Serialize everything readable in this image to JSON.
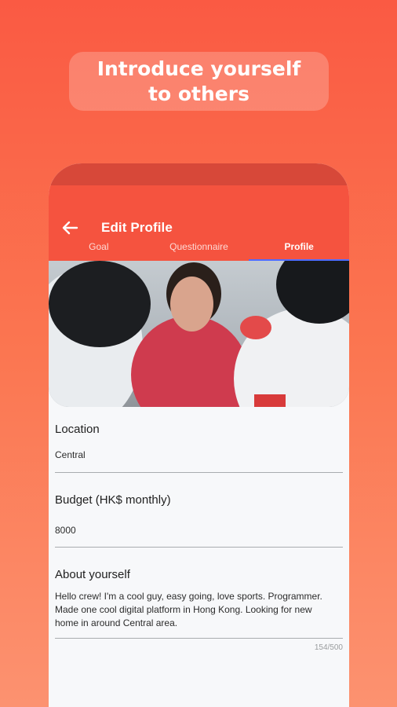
{
  "promo": {
    "line1": "Introduce yourself",
    "line2": "to others"
  },
  "appbar": {
    "title": "Edit Profile",
    "back_icon": "arrow-left-icon"
  },
  "tabs": [
    {
      "label": "Goal",
      "active": false
    },
    {
      "label": "Questionnaire",
      "active": false
    },
    {
      "label": "Profile",
      "active": true
    }
  ],
  "form": {
    "location": {
      "label": "Location",
      "value": "Central"
    },
    "budget": {
      "label": "Budget (HK$ monthly)",
      "value": "8000"
    },
    "about": {
      "label": "About yourself",
      "value": "Hello crew! I'm a cool guy, easy going, love sports. Programmer. Made one cool digital platform in Hong Kong. Looking for new home in around Central area.",
      "counter": "154/500"
    }
  },
  "colors": {
    "accent": "#f5533f",
    "tab_indicator": "#4f6cff",
    "background_top": "#fa5a43",
    "background_bottom": "#fc9270"
  }
}
